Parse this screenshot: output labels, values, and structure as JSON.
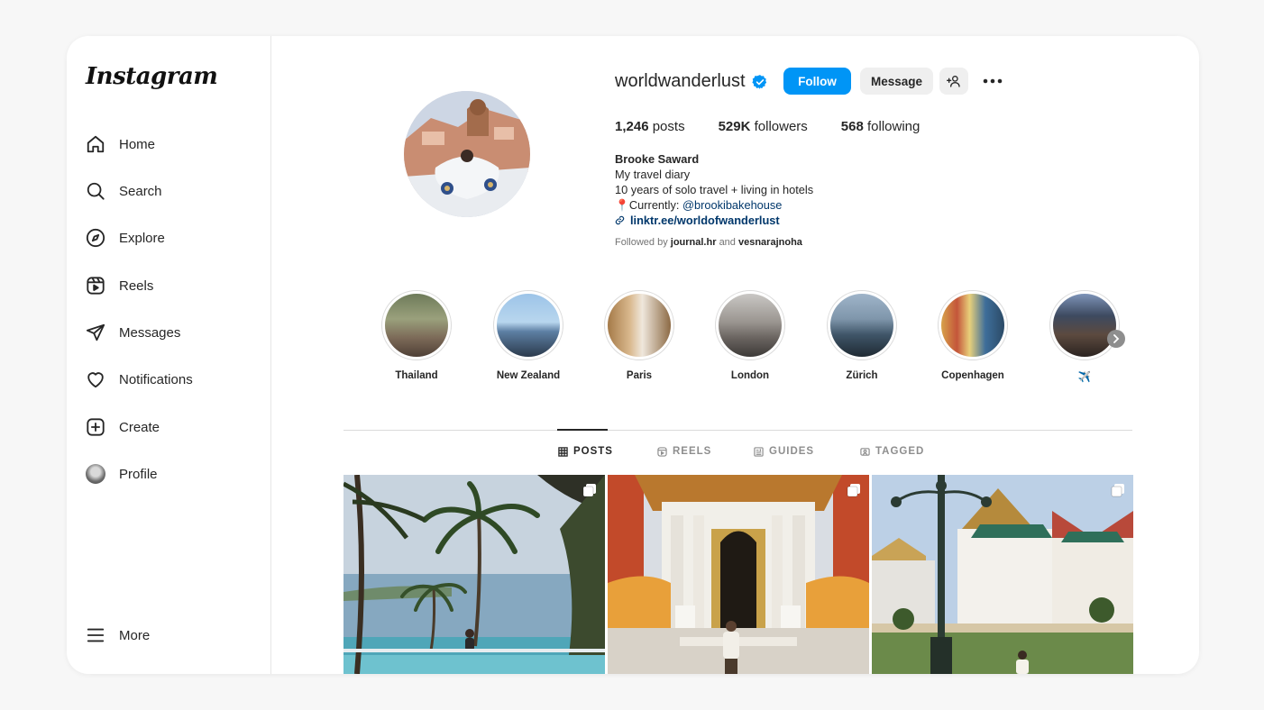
{
  "app": {
    "logo": "Instagram"
  },
  "sidebar": {
    "items": [
      {
        "label": "Home",
        "icon": "home-icon"
      },
      {
        "label": "Search",
        "icon": "search-icon"
      },
      {
        "label": "Explore",
        "icon": "compass-icon"
      },
      {
        "label": "Reels",
        "icon": "reels-icon"
      },
      {
        "label": "Messages",
        "icon": "send-icon"
      },
      {
        "label": "Notifications",
        "icon": "heart-icon"
      },
      {
        "label": "Create",
        "icon": "plus-square-icon"
      },
      {
        "label": "Profile",
        "icon": "profile-avatar-icon"
      }
    ],
    "more": {
      "label": "More",
      "icon": "hamburger-icon"
    }
  },
  "profile": {
    "username": "worldwanderlust",
    "verified": true,
    "follow_label": "Follow",
    "message_label": "Message",
    "stats": {
      "posts": "1,246",
      "posts_label": "posts",
      "followers": "529K",
      "followers_label": "followers",
      "following": "568",
      "following_label": "following"
    },
    "bio": {
      "name": "Brooke Saward",
      "line1": "My travel diary",
      "line2": "10 years of solo travel + living in hotels",
      "currently_prefix": "📍Currently: ",
      "currently_mention": "@brookibakehouse",
      "link": "linktr.ee/worldofwanderlust"
    },
    "followed_by": {
      "prefix": "Followed by",
      "user1": "journal.hr",
      "joiner": "and",
      "user2": "vesnarajnoha"
    }
  },
  "highlights": [
    {
      "label": "Thailand"
    },
    {
      "label": "New Zealand"
    },
    {
      "label": "Paris"
    },
    {
      "label": "London"
    },
    {
      "label": "Zürich"
    },
    {
      "label": "Copenhagen"
    },
    {
      "label": "✈️"
    }
  ],
  "tabs": [
    {
      "label": "POSTS",
      "icon": "grid-icon",
      "active": true
    },
    {
      "label": "REELS",
      "icon": "reels-icon",
      "active": false
    },
    {
      "label": "GUIDES",
      "icon": "guides-icon",
      "active": false
    },
    {
      "label": "TAGGED",
      "icon": "tagged-icon",
      "active": false
    }
  ],
  "colors": {
    "accent": "#0095f6",
    "link": "#00376b",
    "verified": "#0095f6"
  }
}
